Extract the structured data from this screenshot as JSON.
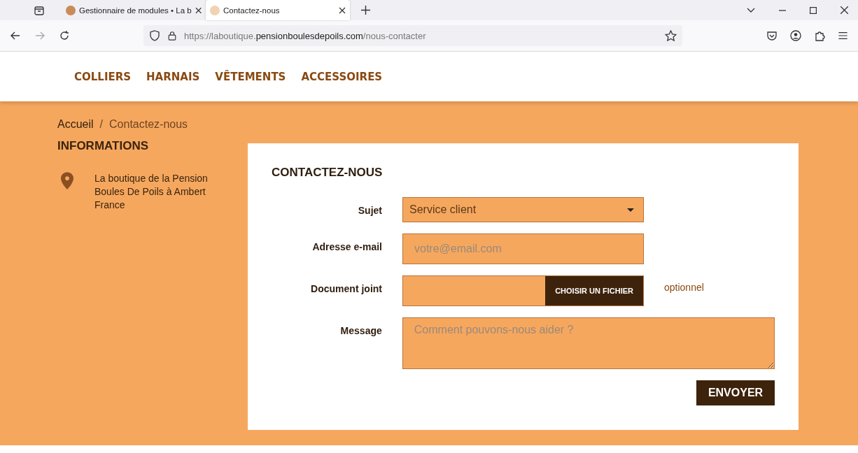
{
  "browser": {
    "tabs": [
      {
        "title": "Gestionnaire de modules • La b",
        "selected": false
      },
      {
        "title": "Contactez-nous",
        "selected": true
      }
    ],
    "url": {
      "prefix": "https://laboutique.",
      "domain": "pensionboulesdepoils.com",
      "path": "/nous-contacter"
    }
  },
  "nav": [
    "COLLIERS",
    "HARNAIS",
    "VÊTEMENTS",
    "ACCESSOIRES"
  ],
  "breadcrumb": [
    {
      "label": "Accueil",
      "current": false
    },
    {
      "label": "Contactez-nous",
      "current": true
    }
  ],
  "breadcrumb_separator": "/",
  "info": {
    "title": "INFORMATIONS",
    "address": [
      "La boutique de la Pension",
      "Boules De Poils à Ambert",
      "France"
    ]
  },
  "form": {
    "title": "CONTACTEZ-NOUS",
    "fields": [
      {
        "kind": "select",
        "label": "Sujet",
        "value": "Service client"
      },
      {
        "kind": "email",
        "label": "Adresse e-mail",
        "placeholder": "votre@email.com"
      },
      {
        "kind": "file",
        "label": "Document joint",
        "button": "CHOISIR UN FICHIER",
        "note": "optionnel"
      },
      {
        "kind": "textarea",
        "label": "Message",
        "placeholder": "Comment pouvons-nous aider ?"
      }
    ],
    "submit": "ENVOYER"
  }
}
